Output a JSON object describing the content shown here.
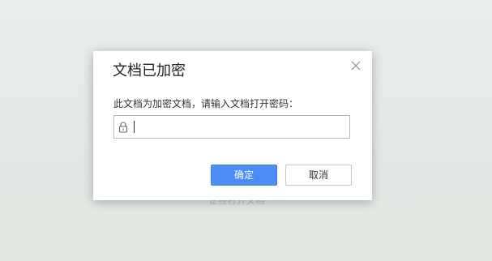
{
  "background": {
    "faded_text": "正在打开文档"
  },
  "dialog": {
    "title": "文档已加密",
    "prompt": "此文档为加密文档，请输入文档打开密码：",
    "password_field": {
      "value": "",
      "placeholder": ""
    },
    "buttons": {
      "ok_label": "确定",
      "cancel_label": "取消"
    },
    "icons": {
      "close": "close-icon",
      "lock": "lock-icon"
    },
    "colors": {
      "primary": "#4b8cf5",
      "border": "#b9b9b9"
    }
  }
}
